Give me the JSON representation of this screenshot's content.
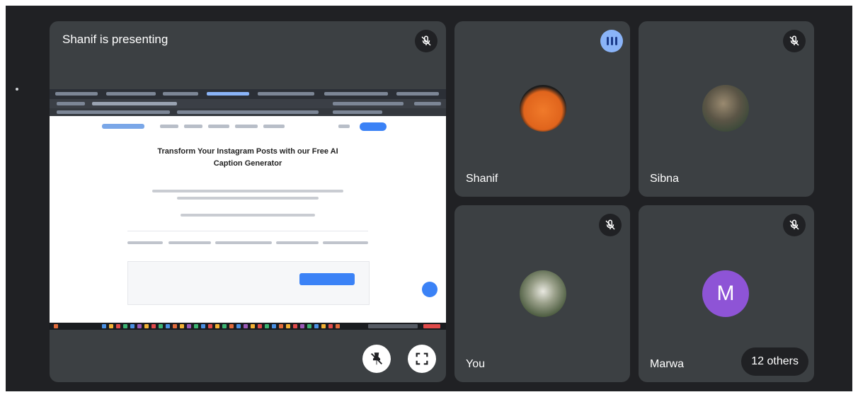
{
  "presentation": {
    "title": "Shanif is presenting",
    "shared_page": {
      "headline": "Transform Your Instagram Posts with our Free AI Caption Generator"
    }
  },
  "participants": [
    {
      "name": "Shanif",
      "speaking": true
    },
    {
      "name": "Sibna",
      "muted": true
    },
    {
      "name": "You",
      "muted": true
    },
    {
      "name": "Marwa",
      "muted": true,
      "avatar_letter": "M"
    }
  ],
  "others_label": "12 others",
  "icons": {
    "mic_off": "mic-off-icon",
    "pin_off": "pin-off-icon",
    "fullscreen": "fullscreen-icon",
    "speaking": "audio-level-icon"
  },
  "colors": {
    "background": "#202124",
    "tile": "#3c4043",
    "avatar_purple": "#8e54d6",
    "speaking_blue": "#8ab4f8"
  }
}
